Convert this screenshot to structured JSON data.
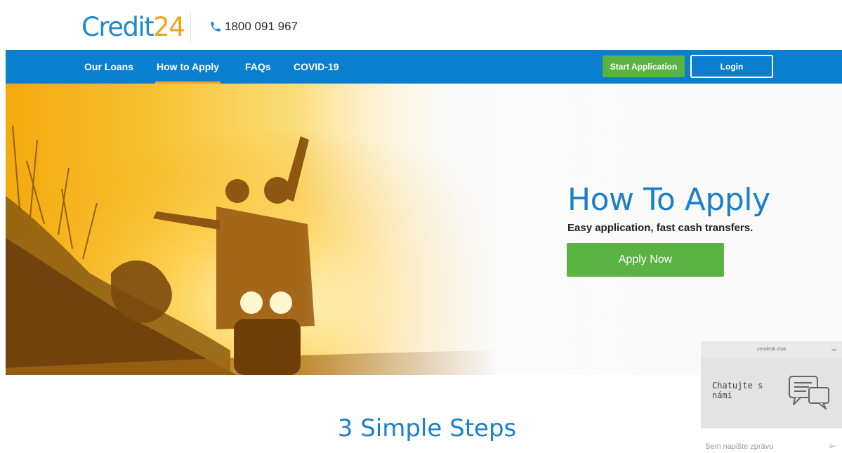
{
  "header": {
    "logo_part1": "Credit",
    "logo_part2": "24",
    "phone": "1800 091 967",
    "phone_icon": "phone-icon"
  },
  "nav": {
    "items": [
      {
        "label": "Our Loans",
        "active": false
      },
      {
        "label": "How to Apply",
        "active": true
      },
      {
        "label": "FAQs",
        "active": false
      },
      {
        "label": "COVID-19",
        "active": false
      }
    ],
    "start_label": "Start Application",
    "login_label": "Login"
  },
  "hero": {
    "title": "How To Apply",
    "subtitle": "Easy application, fast cash transfers.",
    "cta": "Apply Now"
  },
  "steps": {
    "title": "3 Simple Steps"
  },
  "chat": {
    "brand": "zendesk chat",
    "minimize": "–",
    "message": "Chatujte s námi",
    "placeholder": "Sem napište zprávu",
    "send_glyph": "➢",
    "icon": "speech-bubbles-icon"
  },
  "colors": {
    "brand_blue": "#0a7fcf",
    "accent_orange": "#f5a21a",
    "cta_green": "#5ab242"
  }
}
